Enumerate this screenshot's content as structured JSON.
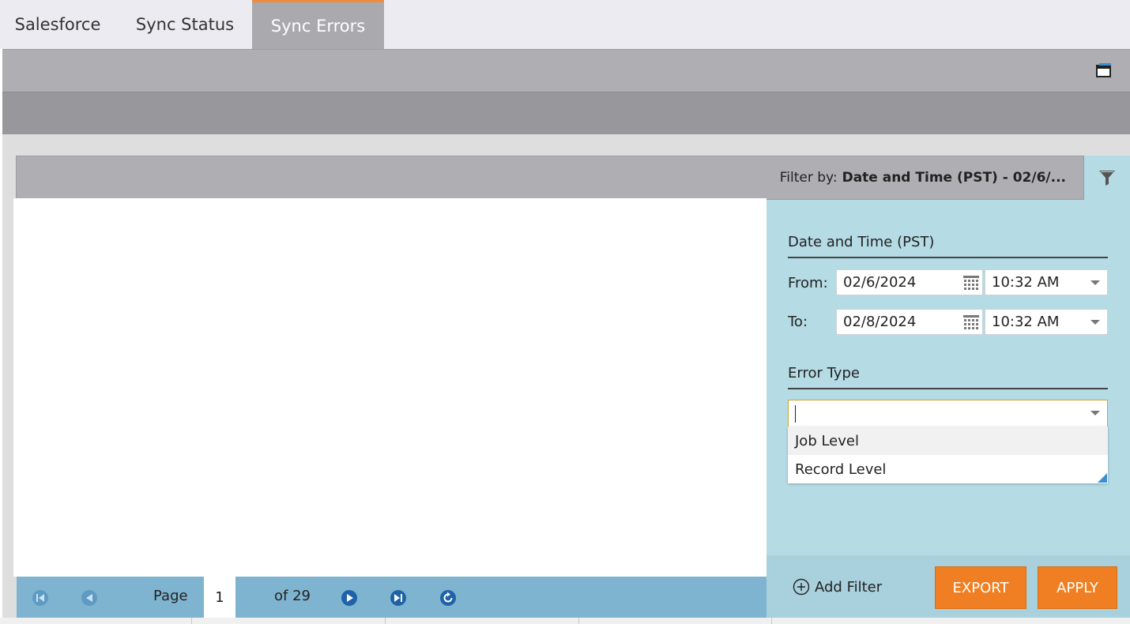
{
  "tabs": [
    {
      "label": "Salesforce",
      "active": false
    },
    {
      "label": "Sync Status",
      "active": false
    },
    {
      "label": "Sync Errors",
      "active": true
    }
  ],
  "filter_bar": {
    "prefix": "Filter by:",
    "value": "Date and Time (PST) - 02/6/..."
  },
  "filter_panel": {
    "date_section_title": "Date and Time (PST)",
    "from_label": "From:",
    "from_date": "02/6/2024",
    "from_time": "10:32 AM",
    "to_label": "To:",
    "to_date": "02/8/2024",
    "to_time": "10:32 AM",
    "error_type_title": "Error Type",
    "error_type_value": "",
    "error_type_options": [
      "Job Level",
      "Record Level"
    ]
  },
  "footer": {
    "add_filter_label": "Add Filter",
    "export_label": "EXPORT",
    "apply_label": "APPLY"
  },
  "pager": {
    "page_label": "Page",
    "current_page": "1",
    "of_label": "of 29"
  },
  "colors": {
    "accent_orange": "#ef7f22",
    "panel_blue": "#b5dbe5",
    "pager_blue": "#7fb4d0",
    "tab_active": "#a9a9ae"
  },
  "icons": [
    "window-icon",
    "funnel-icon",
    "calendar-icon",
    "first-page-icon",
    "prev-page-icon",
    "next-page-icon",
    "last-page-icon",
    "refresh-icon",
    "add-circle-icon"
  ]
}
